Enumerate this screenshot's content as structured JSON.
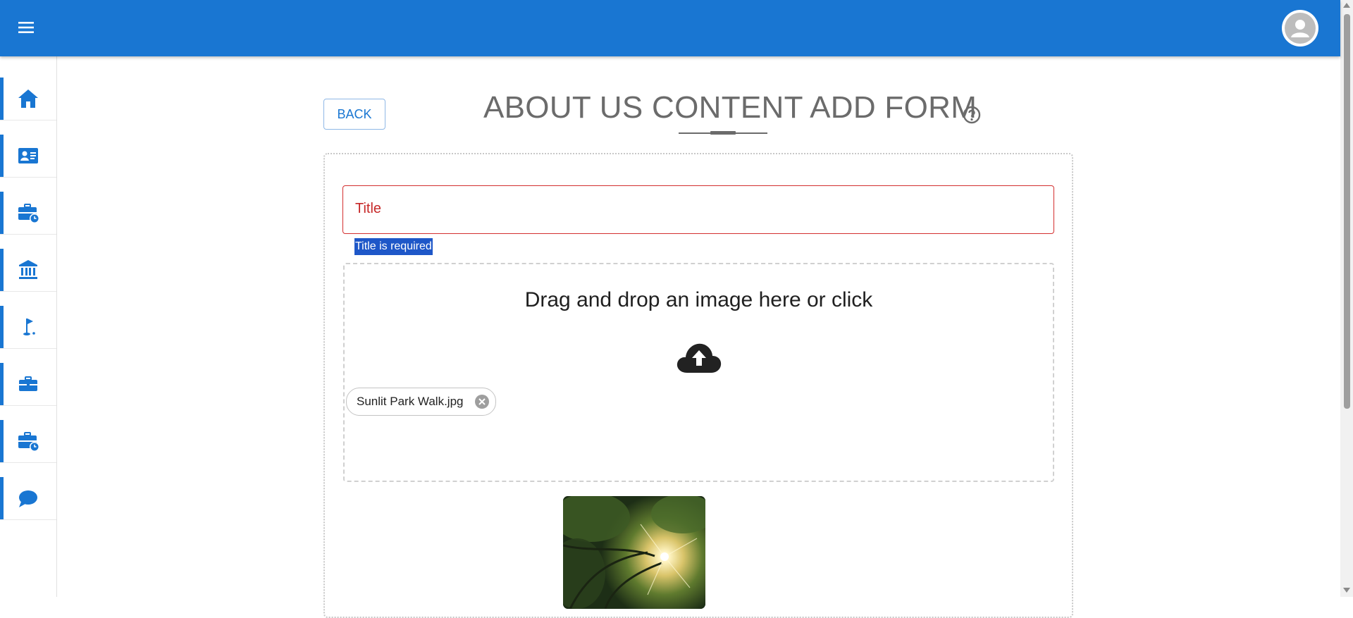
{
  "appbar": {
    "menu_icon": "hamburger-menu-icon",
    "account_icon": "account-circle-icon",
    "color": "#1976d2"
  },
  "sidebar": {
    "items": [
      {
        "id": "home",
        "icon": "home-icon"
      },
      {
        "id": "about",
        "icon": "contact-card-icon"
      },
      {
        "id": "jobs-pending",
        "icon": "briefcase-clock-icon"
      },
      {
        "id": "institution",
        "icon": "bank-icon"
      },
      {
        "id": "golf",
        "icon": "golf-flag-icon"
      },
      {
        "id": "business",
        "icon": "briefcase-icon"
      },
      {
        "id": "work-history",
        "icon": "briefcase-clock-icon"
      },
      {
        "id": "messages",
        "icon": "chat-bubble-icon"
      }
    ]
  },
  "page": {
    "back_label": "BACK",
    "title": "ABOUT US CONTENT ADD FORM",
    "help_icon": "help-circle-icon"
  },
  "form": {
    "title_placeholder": "Title",
    "title_error": "Title is required",
    "dropzone_text": "Drag and drop an image here or click",
    "upload_icon": "cloud-upload-icon",
    "file_chip_label": "Sunlit Park Walk.jpg",
    "chip_remove_icon": "cancel-circle-icon",
    "preview_image": "sunlit-trees-photo",
    "error_color": "#d32f2f"
  }
}
